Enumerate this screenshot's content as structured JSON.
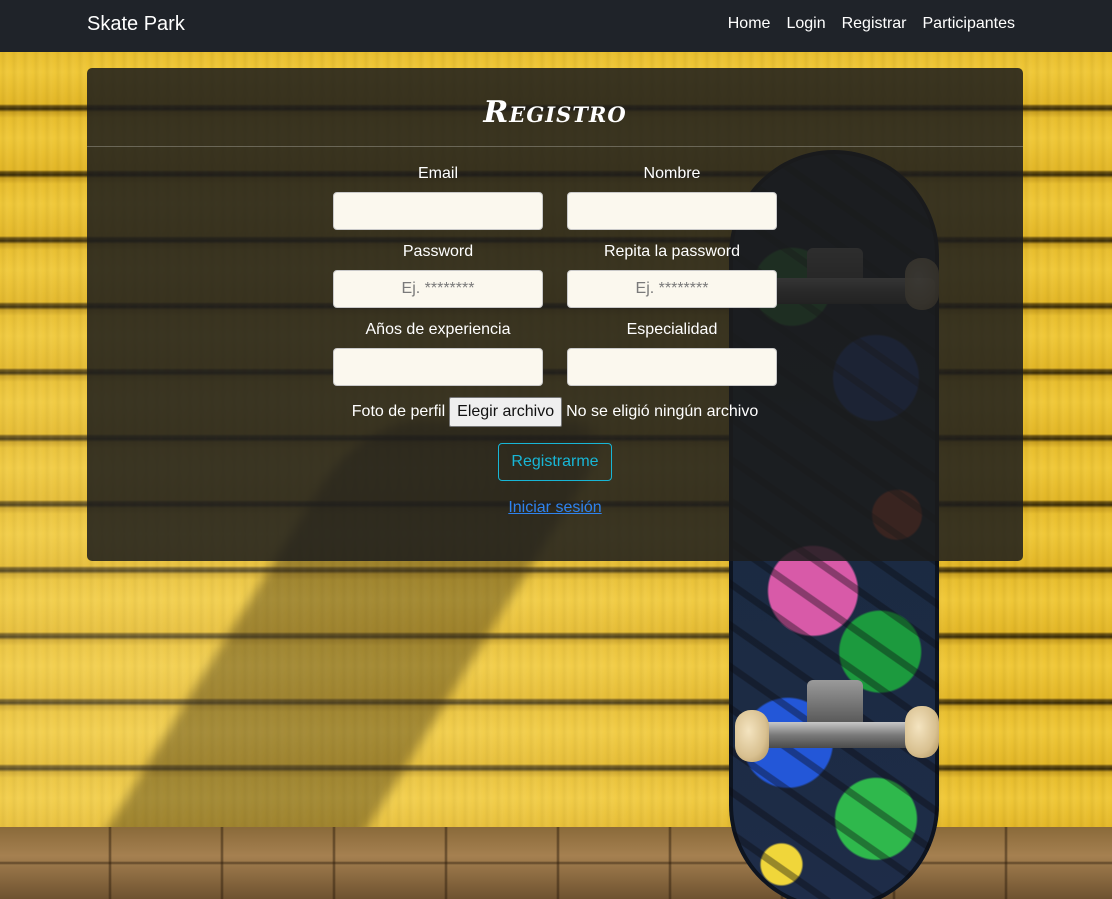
{
  "navbar": {
    "brand": "Skate Park",
    "links": [
      {
        "label": "Home"
      },
      {
        "label": "Login"
      },
      {
        "label": "Registrar"
      },
      {
        "label": "Participantes"
      }
    ]
  },
  "form": {
    "title": "Registro",
    "fields": {
      "email": {
        "label": "Email",
        "value": "",
        "placeholder": ""
      },
      "nombre": {
        "label": "Nombre",
        "value": "",
        "placeholder": ""
      },
      "password": {
        "label": "Password",
        "value": "",
        "placeholder": "Ej. ********"
      },
      "password_repeat": {
        "label": "Repita la password",
        "value": "",
        "placeholder": "Ej. ********"
      },
      "experiencia": {
        "label": "Años de experiencia",
        "value": "",
        "placeholder": ""
      },
      "especialidad": {
        "label": "Especialidad",
        "value": "",
        "placeholder": ""
      }
    },
    "file": {
      "label": "Foto de perfil",
      "button_label": "Elegir archivo",
      "status": "No se eligió ningún archivo"
    },
    "submit_label": "Registrarme",
    "login_link": "Iniciar sesión"
  },
  "colors": {
    "navbar_bg": "#1f2329",
    "card_bg": "rgba(28,28,28,0.86)",
    "accent_info": "#18b6d6",
    "link": "#2f83ee",
    "wall_yellow": "#e8be2e"
  }
}
